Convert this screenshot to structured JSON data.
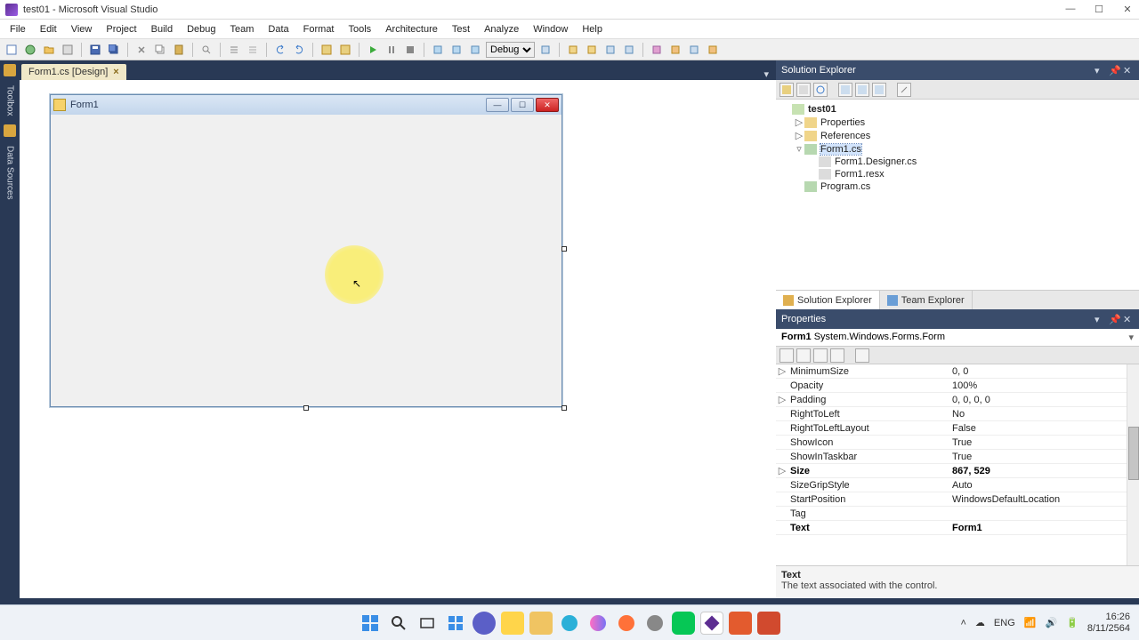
{
  "titlebar": {
    "title": "test01 - Microsoft Visual Studio"
  },
  "menu": [
    "File",
    "Edit",
    "View",
    "Project",
    "Build",
    "Debug",
    "Team",
    "Data",
    "Format",
    "Tools",
    "Architecture",
    "Test",
    "Analyze",
    "Window",
    "Help"
  ],
  "toolbar": {
    "config": "Debug"
  },
  "leftRail": {
    "tab1": "Toolbox",
    "tab2": "Data Sources"
  },
  "docTab": {
    "label": "Form1.cs [Design]"
  },
  "form": {
    "title": "Form1"
  },
  "solutionExplorer": {
    "title": "Solution Explorer",
    "nodes": {
      "project": "test01",
      "properties": "Properties",
      "references": "References",
      "form1": "Form1.cs",
      "designer": "Form1.Designer.cs",
      "resx": "Form1.resx",
      "program": "Program.cs"
    },
    "bottomTabs": {
      "se": "Solution Explorer",
      "te": "Team Explorer"
    }
  },
  "properties": {
    "title": "Properties",
    "objectName": "Form1",
    "objectType": "System.Windows.Forms.Form",
    "rows": [
      {
        "exp": "▷",
        "name": "MinimumSize",
        "val": "0, 0"
      },
      {
        "exp": "",
        "name": "Opacity",
        "val": "100%"
      },
      {
        "exp": "▷",
        "name": "Padding",
        "val": "0, 0, 0, 0"
      },
      {
        "exp": "",
        "name": "RightToLeft",
        "val": "No"
      },
      {
        "exp": "",
        "name": "RightToLeftLayout",
        "val": "False"
      },
      {
        "exp": "",
        "name": "ShowIcon",
        "val": "True"
      },
      {
        "exp": "",
        "name": "ShowInTaskbar",
        "val": "True"
      },
      {
        "exp": "▷",
        "name": "Size",
        "val": "867, 529",
        "bold": true
      },
      {
        "exp": "",
        "name": "SizeGripStyle",
        "val": "Auto"
      },
      {
        "exp": "",
        "name": "StartPosition",
        "val": "WindowsDefaultLocation"
      },
      {
        "exp": "",
        "name": "Tag",
        "val": ""
      },
      {
        "exp": "",
        "name": "Text",
        "val": "Form1",
        "bold": true
      }
    ],
    "desc": {
      "name": "Text",
      "text": "The text associated with the control."
    }
  },
  "taskbar": {
    "tray": {
      "lang": "ENG",
      "time": "16:26",
      "date": "8/11/2564"
    }
  }
}
